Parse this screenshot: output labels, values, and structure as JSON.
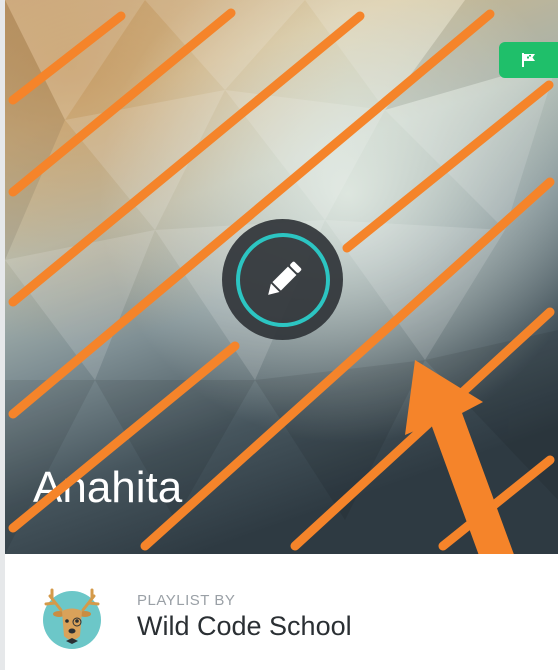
{
  "playlist": {
    "title": "Anahita",
    "owner_caption": "PLAYLIST BY",
    "owner_name": "Wild Code School"
  },
  "icons": {
    "flag": "flag-icon",
    "edit": "pencil-icon",
    "avatar": "deer-avatar"
  },
  "colors": {
    "badge_green": "#1fbf6a",
    "edit_ring_teal": "#2cc5c2",
    "annotation_orange": "#f5842a",
    "avatar_teal": "#6cc7c8"
  }
}
